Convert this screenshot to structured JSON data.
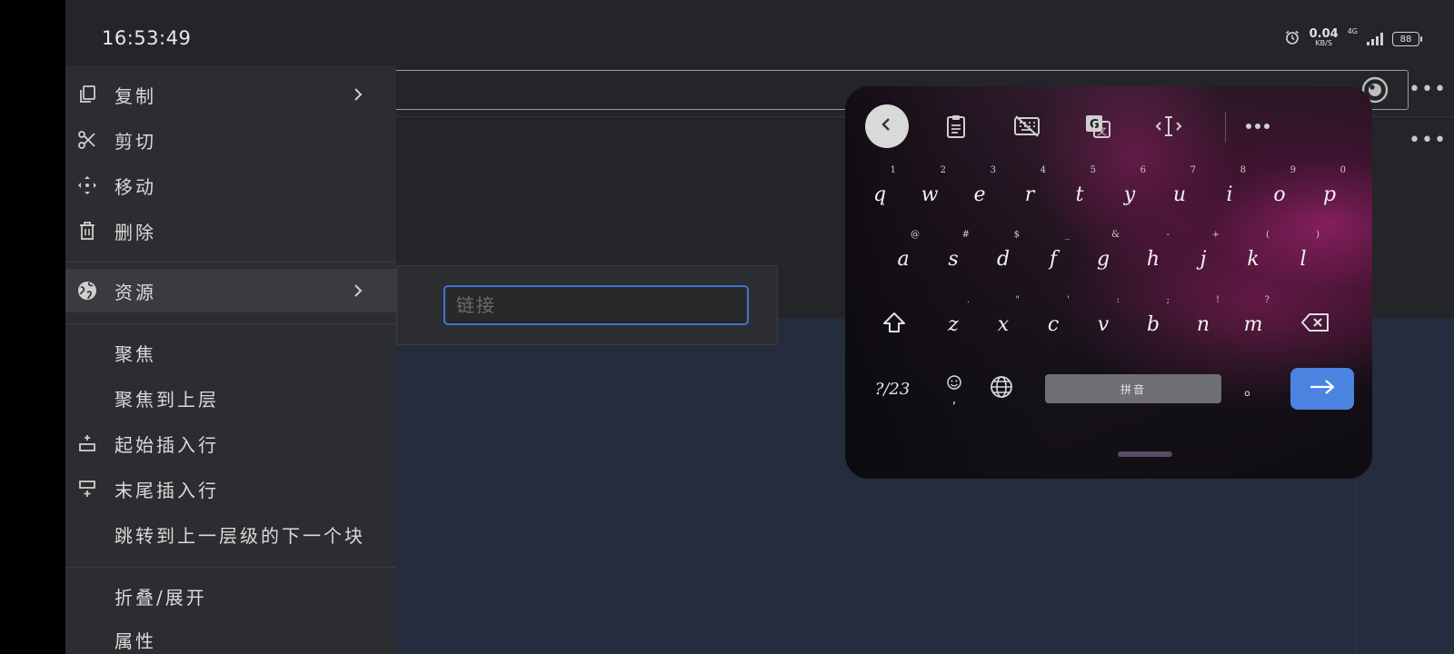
{
  "status_bar": {
    "time": "16:53:49",
    "net_speed_value": "0.04",
    "net_speed_unit": "KB/S",
    "network_type": "4G",
    "battery": "88"
  },
  "context_menu": {
    "items": [
      {
        "label": "复制",
        "icon": "copy-icon",
        "has_submenu": true
      },
      {
        "label": "剪切",
        "icon": "scissors-icon",
        "has_submenu": false
      },
      {
        "label": "移动",
        "icon": "move-icon",
        "has_submenu": false
      },
      {
        "label": "删除",
        "icon": "trash-icon",
        "has_submenu": false
      },
      {
        "label": "资源",
        "icon": "globe-icon",
        "has_submenu": true,
        "active": true
      },
      {
        "label": "聚焦"
      },
      {
        "label": "聚焦到上层"
      },
      {
        "label": "起始插入行",
        "icon": "insert-before-icon"
      },
      {
        "label": "末尾插入行",
        "icon": "insert-after-icon"
      },
      {
        "label": "跳转到上一层级的下一个块"
      },
      {
        "label": "折叠/展开"
      },
      {
        "label": "属性"
      }
    ]
  },
  "submenu": {
    "link_placeholder": "链接",
    "link_value": ""
  },
  "keyboard": {
    "row1": [
      {
        "k": "q",
        "h": "1"
      },
      {
        "k": "w",
        "h": "2"
      },
      {
        "k": "e",
        "h": "3"
      },
      {
        "k": "r",
        "h": "4"
      },
      {
        "k": "t",
        "h": "5"
      },
      {
        "k": "y",
        "h": "6"
      },
      {
        "k": "u",
        "h": "7"
      },
      {
        "k": "i",
        "h": "8"
      },
      {
        "k": "o",
        "h": "9"
      },
      {
        "k": "p",
        "h": "0"
      }
    ],
    "row2": [
      {
        "k": "a",
        "h": "@"
      },
      {
        "k": "s",
        "h": "#"
      },
      {
        "k": "d",
        "h": "$"
      },
      {
        "k": "f",
        "h": "_"
      },
      {
        "k": "g",
        "h": "&"
      },
      {
        "k": "h",
        "h": "-"
      },
      {
        "k": "j",
        "h": "+"
      },
      {
        "k": "k",
        "h": "("
      },
      {
        "k": "l",
        "h": ")"
      }
    ],
    "row3": [
      {
        "k": "z",
        "h": "."
      },
      {
        "k": "x",
        "h": "\""
      },
      {
        "k": "c",
        "h": "'"
      },
      {
        "k": "v",
        "h": ":"
      },
      {
        "k": "b",
        "h": ";"
      },
      {
        "k": "n",
        "h": "!"
      },
      {
        "k": "m",
        "h": "?"
      }
    ],
    "symbols_label": "?/23",
    "emoji_comma": ",",
    "space_label": "拼音",
    "period_label": "。",
    "accent_color": "#4b83e0"
  }
}
